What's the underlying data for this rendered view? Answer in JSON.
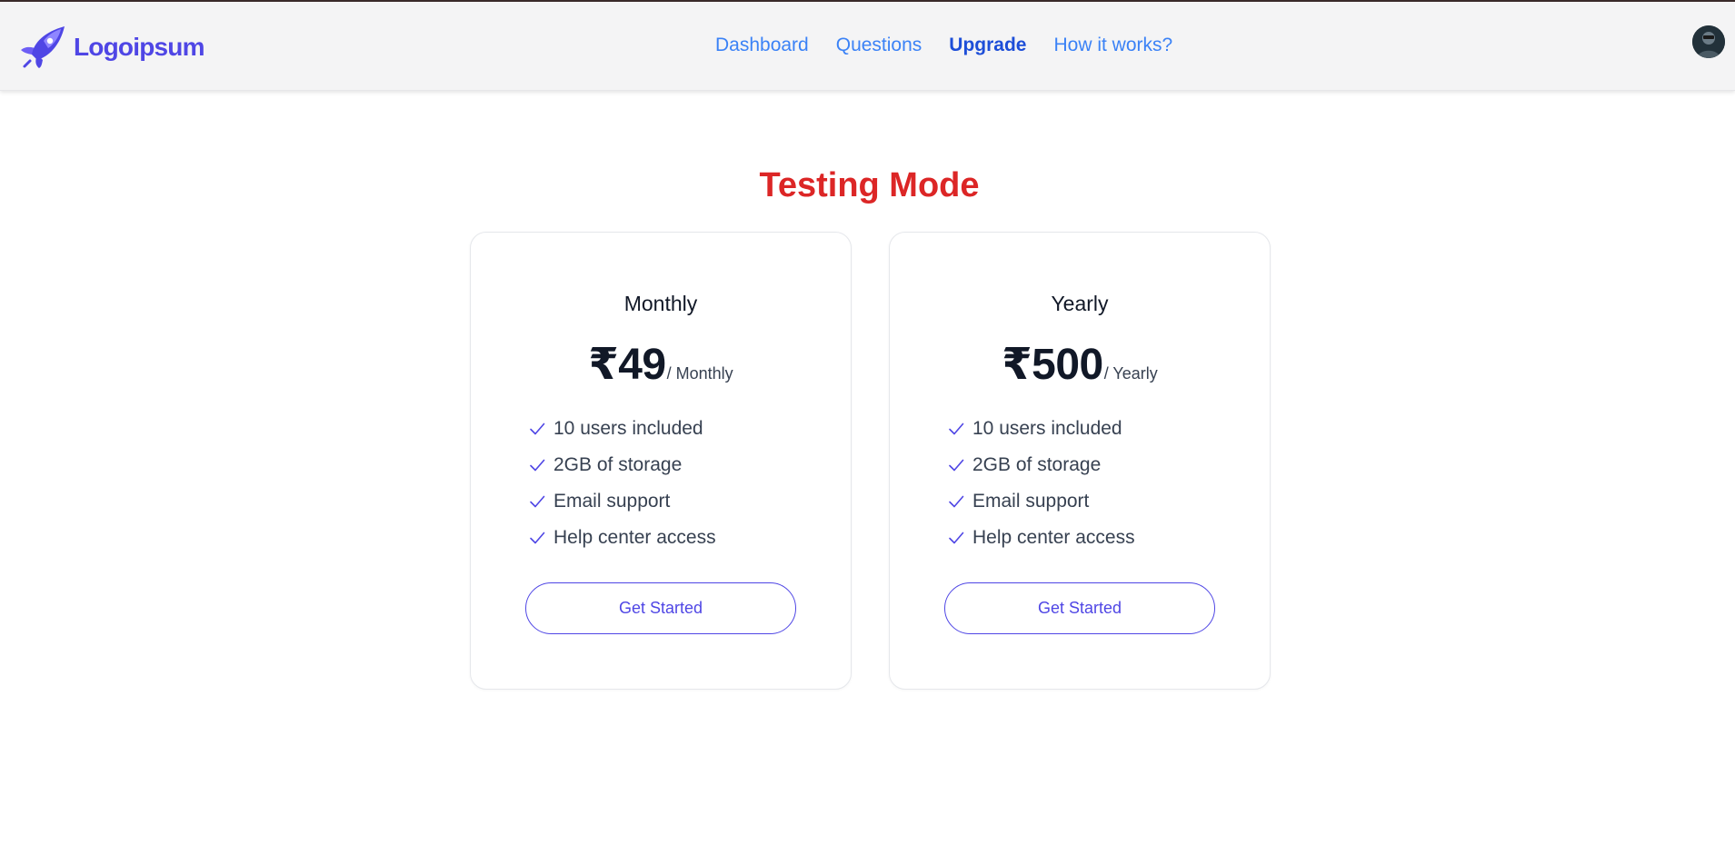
{
  "brand": {
    "name": "Logoipsum",
    "logo_icon": "rocket-icon",
    "color": "#4f46e5"
  },
  "nav": {
    "links": [
      {
        "label": "Dashboard",
        "active": false
      },
      {
        "label": "Questions",
        "active": false
      },
      {
        "label": "Upgrade",
        "active": true
      },
      {
        "label": "How it works?",
        "active": false
      }
    ],
    "link_color": "#3b82f6",
    "active_color": "#1d4ed8"
  },
  "user": {
    "avatar_icon": "user-avatar"
  },
  "page": {
    "title": "Testing Mode",
    "title_color": "#dc2626"
  },
  "plans": [
    {
      "name": "Monthly",
      "price": "₹49",
      "period": "/ Monthly",
      "features": [
        "10 users included",
        "2GB of storage",
        "Email support",
        "Help center access"
      ],
      "cta": "Get Started"
    },
    {
      "name": "Yearly",
      "price": "₹500",
      "period": "/ Yearly",
      "features": [
        "10 users included",
        "2GB of storage",
        "Email support",
        "Help center access"
      ],
      "cta": "Get Started"
    }
  ],
  "feature_icon": "check-icon"
}
